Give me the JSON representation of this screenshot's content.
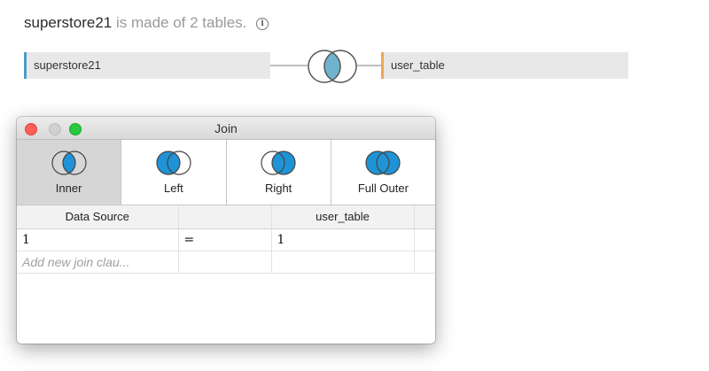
{
  "header": {
    "datasource_name": "superstore21",
    "description": "is made of 2 tables."
  },
  "tables": {
    "left": {
      "name": "superstore21",
      "accent": "#4a9bc6"
    },
    "right": {
      "name": "user_table",
      "accent": "#f0a55a"
    }
  },
  "join_dialog": {
    "title": "Join",
    "join_types": [
      {
        "label": "Inner",
        "selected": true
      },
      {
        "label": "Left",
        "selected": false
      },
      {
        "label": "Right",
        "selected": false
      },
      {
        "label": "Full Outer",
        "selected": false
      }
    ],
    "columns": {
      "left_header": "Data Source",
      "operator_header": "",
      "right_header": "user_table"
    },
    "clauses": [
      {
        "left": "1",
        "operator": "=",
        "right": "1"
      }
    ],
    "add_clause_placeholder": "Add new join clau..."
  },
  "colors": {
    "join_fill": "#1f93d6",
    "join_overlap_light": "#6fb4cc"
  }
}
